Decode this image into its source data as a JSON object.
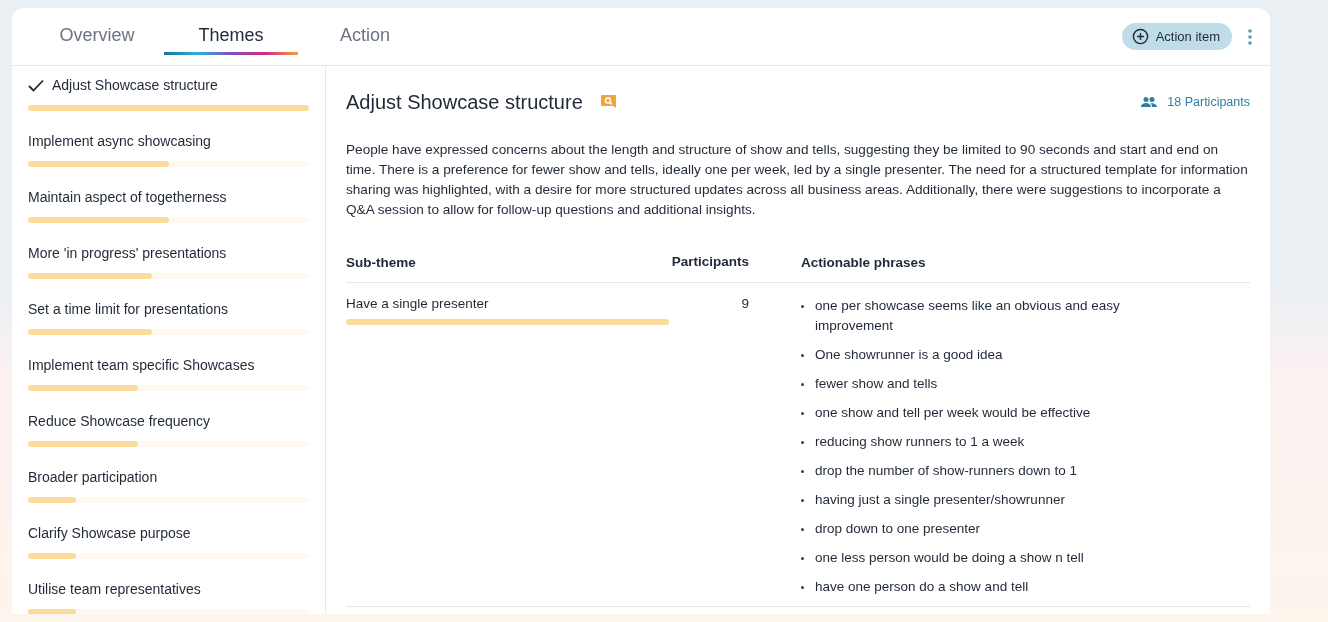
{
  "tabs": [
    {
      "label": "Overview",
      "selected": false
    },
    {
      "label": "Themes",
      "selected": true
    },
    {
      "label": "Action",
      "selected": false
    }
  ],
  "action_button": "Action item",
  "themes": [
    {
      "label": "Adjust Showcase structure",
      "selected": true,
      "level": 1
    },
    {
      "label": "Implement async showcasing",
      "selected": false,
      "level": 0.5
    },
    {
      "label": "Maintain aspect of togetherness",
      "selected": false,
      "level": 0.5
    },
    {
      "label": "More 'in progress' presentations",
      "selected": false,
      "level": 0.44
    },
    {
      "label": "Set a time limit for presentations",
      "selected": false,
      "level": 0.44
    },
    {
      "label": "Implement team specific Showcases",
      "selected": false,
      "level": 0.39
    },
    {
      "label": "Reduce Showcase frequency",
      "selected": false,
      "level": 0.39
    },
    {
      "label": "Broader participation",
      "selected": false,
      "level": 0.17
    },
    {
      "label": "Clarify Showcase purpose",
      "selected": false,
      "level": 0.17
    },
    {
      "label": "Utilise team representatives",
      "selected": false,
      "level": 0.17
    }
  ],
  "detail": {
    "title": "Adjust Showcase structure",
    "participants": "18 Participants",
    "summary": "People have expressed concerns about the length and structure of show and tells, suggesting they be limited to 90 seconds and start and end on time. There is a preference for fewer show and tells, ideally one per week, led by a single presenter. The need for a structured template for information sharing was highlighted, with a desire for more structured updates across all business areas. Additionally, there were suggestions to incorporate a Q&A session to allow for follow-up questions and additional insights.",
    "table": {
      "columns": [
        "Sub-theme",
        "Participants",
        "Actionable phrases"
      ],
      "rows": [
        {
          "sub_theme": "Have a single presenter",
          "level": 1,
          "participants": "9",
          "phrases": [
            "one per showcase seems like an obvious and easy improvement",
            "One showrunner is a good idea",
            "fewer show and tells",
            "one show and tell per week would be effective",
            "reducing show runners to 1 a week",
            "drop the number of show-runners down to 1",
            "having just a single presenter/showrunner",
            "drop down to one presenter",
            "one less person would be doing a show n tell",
            "have one person do a show and tell"
          ]
        }
      ]
    }
  }
}
